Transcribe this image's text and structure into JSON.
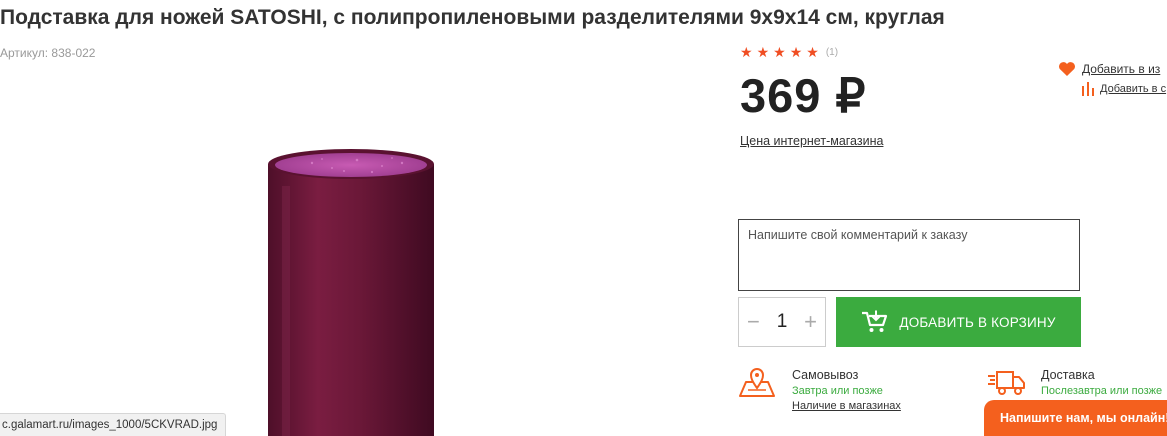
{
  "product": {
    "title": "Подставка для ножей SATOSHI, с полипропиленовыми разделителями 9х9х14 см, круглая",
    "sku_label": "Артикул:",
    "sku_value": "838-022",
    "image_icon": "knife-stand-product-photo",
    "colors": {
      "body": "#6d1838",
      "filling": "#b44aa0"
    }
  },
  "rating": {
    "stars_filled": 5,
    "stars_total": 5,
    "count": "(1)",
    "star_color": "#f04e23"
  },
  "price": {
    "value": "369",
    "currency": "₽",
    "note": "Цена интернет-магазина"
  },
  "actions": {
    "favorites_label": "Добавить в из",
    "favorites_icon": "heart-icon",
    "compare_label": "Добавить в с",
    "compare_icon": "compare-bars-icon",
    "accent": "#f4601e"
  },
  "order": {
    "comment_placeholder": "Напишите свой комментарий к заказу",
    "quantity": "1",
    "minus": "−",
    "plus": "+",
    "add_to_cart": "Добавить в корзину",
    "cart_icon": "cart-icon",
    "button_color": "#3bab3f"
  },
  "shipping": {
    "pickup_title": "Самовывоз",
    "pickup_sub": "Завтра или позже",
    "pickup_link": "Наличие в магазинах",
    "pickup_icon": "pickup-map-icon",
    "delivery_title": "Доставка",
    "delivery_sub": "Послезавтра или позже",
    "delivery_icon": "delivery-truck-icon"
  },
  "status_bar": {
    "url": "c.galamart.ru/images_1000/5CKVRAD.jpg"
  },
  "chat": {
    "label": "Напишите нам, мы онлайн!"
  }
}
